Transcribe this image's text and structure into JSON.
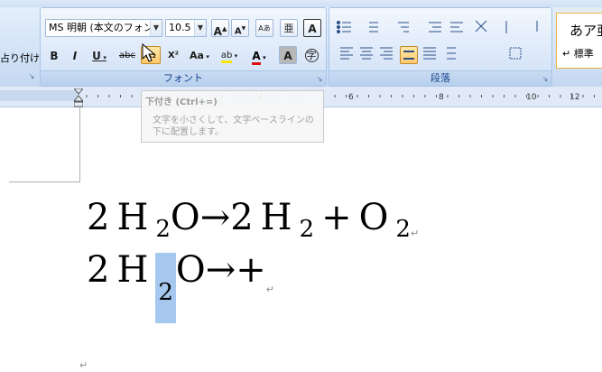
{
  "ribbon": {
    "left_partial_label": "占り付け",
    "font_group": {
      "label": "フォント",
      "font_name": "MS 明朝 (本文のフォン",
      "font_size": "10.5",
      "grow_font": "A",
      "shrink_font": "A",
      "clear_format": "Aあ",
      "phonetic": "亜",
      "char_border": "A",
      "bold": "B",
      "italic": "I",
      "underline": "U",
      "strikethrough": "abc",
      "subscript": "X₂",
      "superscript": "X²",
      "change_case": "Aa",
      "highlight": "ab",
      "font_color": "A",
      "char_shading": "A",
      "enclose_char": "字"
    },
    "paragraph_group": {
      "label": "段落"
    },
    "styles": {
      "preview_text": "あア亜",
      "style_name": "↵ 標準"
    }
  },
  "tooltip": {
    "title": "下付き (Ctrl+=)",
    "description": "文字を小さくして、文字ベースラインの下に配置します。"
  },
  "document": {
    "line1": {
      "n1": "2",
      "h1": "H",
      "sub1": "2",
      "o1": "O",
      "arrow": "→",
      "n2": "2",
      "h2": "H",
      "sub2": "2",
      "plus": "+",
      "o2": "O",
      "sub3": "2",
      "para": "↵"
    },
    "line2": {
      "n1": "2",
      "h1": "H",
      "sub1": "2",
      "o1": "O",
      "arrow": "→",
      "plus": "+",
      "para": "↵"
    },
    "end_para": "↵"
  },
  "colors": {
    "ribbon_label": "#15428b",
    "selection": "#a6c8ee",
    "active_button": "#ffc96b"
  }
}
